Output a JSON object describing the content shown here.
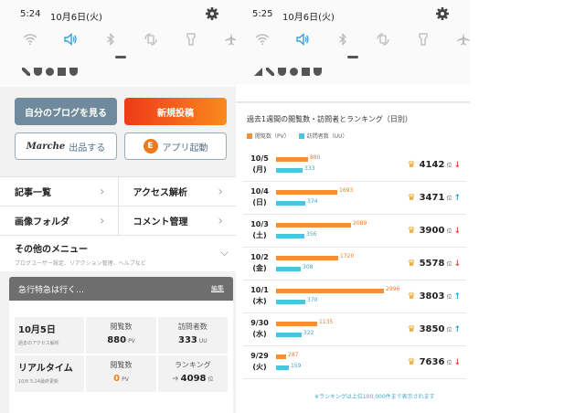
{
  "left": {
    "status": {
      "time": "5:24",
      "date": "10月6日(火)"
    },
    "buttons": {
      "my_blog": "自分のブログを見る",
      "new_post": "新規投稿",
      "marche_logo": "Marche",
      "marche": "出品する",
      "app": "アプリ起動"
    },
    "menu": [
      {
        "label": "記事一覧"
      },
      {
        "label": "アクセス解析"
      },
      {
        "label": "画像フォルダ"
      },
      {
        "label": "コメント管理"
      }
    ],
    "other_menu": {
      "title": "その他のメニュー",
      "sub": "ブログユーザー設定、リアクション管理、ヘルプなど"
    },
    "blog": {
      "title": "急行特急は行く…",
      "edit": "編集"
    },
    "stats": {
      "date": "10月5日",
      "date_sub": "過去のアクセス解析",
      "pv_label": "閲覧数",
      "pv_value": "880",
      "pv_unit": "PV",
      "uu_label": "訪問者数",
      "uu_value": "333",
      "uu_unit": "UU",
      "rt_title": "リアルタイム",
      "rt_sub": "10/6 5:24最終更新",
      "rt_pv_label": "閲覧数",
      "rt_pv_value": "0",
      "rt_pv_unit": "PV",
      "rank_label": "ランキング",
      "rank_value": "4098",
      "rank_unit": "位"
    }
  },
  "right": {
    "status": {
      "time": "5:25",
      "date": "10月6日(火)"
    },
    "title": "過去1週間の閲覧数・訪問者とランキング（日別）",
    "legend": {
      "pv": "閲覧数（PV）",
      "uu": "訪問者数（UU）"
    },
    "rank_suffix": "位",
    "note": "※ランキングは上位100,000件まで表示されます",
    "colors": {
      "pv": "#f09039",
      "uu": "#4cc3e3",
      "down": "#e44c3a",
      "up": "#2e9fd6"
    },
    "rows": [
      {
        "date": "10/5",
        "day": "(月)",
        "pv": 880,
        "uu": 333,
        "rank": "4142",
        "trend": "down"
      },
      {
        "date": "10/4",
        "day": "(日)",
        "pv": 1693,
        "uu": 374,
        "rank": "3471",
        "trend": "up"
      },
      {
        "date": "10/3",
        "day": "(土)",
        "pv": 2089,
        "uu": 356,
        "rank": "3900",
        "trend": "down"
      },
      {
        "date": "10/2",
        "day": "(金)",
        "pv": 1720,
        "uu": 308,
        "rank": "5578",
        "trend": "down"
      },
      {
        "date": "10/1",
        "day": "(木)",
        "pv": 2996,
        "uu": 370,
        "rank": "3803",
        "trend": "up"
      },
      {
        "date": "9/30",
        "day": "(水)",
        "pv": 1135,
        "uu": 322,
        "rank": "3850",
        "trend": "up"
      },
      {
        "date": "9/29",
        "day": "(火)",
        "pv": 287,
        "uu": 159,
        "rank": "7636",
        "trend": "down"
      }
    ]
  }
}
